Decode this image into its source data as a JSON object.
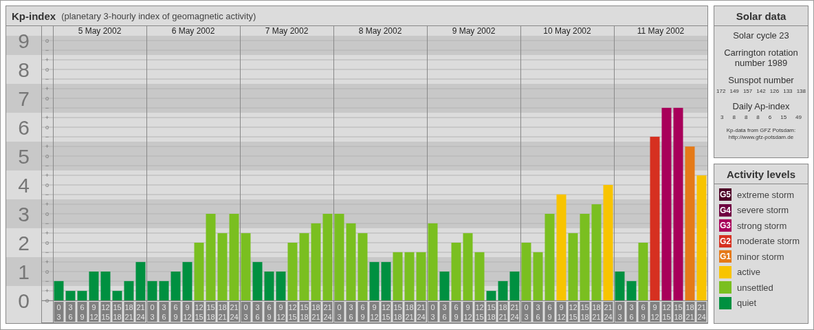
{
  "header": {
    "title": "Kp-index",
    "subtitle": "(planetary 3-hourly index of geomagnetic activity)"
  },
  "days": [
    "5 May 2002",
    "6 May 2002",
    "7 May 2002",
    "8 May 2002",
    "9 May 2002",
    "10 May 2002",
    "11 May 2002"
  ],
  "kp_subdivisions": [
    "o",
    "−",
    "+",
    "o",
    "−",
    "+",
    "o",
    "−",
    "+",
    "o",
    "−",
    "+",
    "o",
    "−",
    "+",
    "o",
    "−",
    "+",
    "o",
    "−",
    "+",
    "o",
    "−",
    "+",
    "o",
    "−",
    "+",
    "o"
  ],
  "chart_data": {
    "type": "bar",
    "grid": true,
    "categories": [
      "0 3",
      "3 6",
      "6 9",
      "9 12",
      "12 15",
      "15 18",
      "18 21",
      "21 24",
      "0 3",
      "3 6",
      "6 9",
      "9 12",
      "12 15",
      "15 18",
      "18 21",
      "21 24",
      "0 3",
      "3 6",
      "6 9",
      "9 12",
      "12 15",
      "15 18",
      "18 21",
      "21 24",
      "0 3",
      "3 6",
      "6 9",
      "9 12",
      "12 15",
      "15 18",
      "18 21",
      "21 24",
      "0 3",
      "3 6",
      "6 9",
      "9 12",
      "12 15",
      "15 18",
      "18 21",
      "21 24",
      "0 3",
      "3 6",
      "6 9",
      "9 12",
      "12 15",
      "15 18",
      "18 21",
      "21 24",
      "0 3",
      "3 6",
      "6 9",
      "9 12",
      "12 15",
      "15 18",
      "18 21",
      "21 24"
    ],
    "ylim": [
      0,
      9.5
    ],
    "yticks": [
      0,
      1,
      2,
      3,
      4,
      5,
      6,
      7,
      8,
      9
    ],
    "series": [
      {
        "color": "#009040",
        "values": [
          0.67,
          0.33,
          0.33,
          1,
          1,
          0.33,
          0.67,
          1.33,
          0.67,
          0.67,
          1,
          1.33,
          null,
          null,
          null,
          null,
          null,
          1.33,
          1,
          1,
          null,
          null,
          null,
          null,
          null,
          null,
          null,
          1.33,
          1.33,
          null,
          null,
          null,
          null,
          1,
          null,
          null,
          null,
          0.33,
          0.67,
          1,
          null,
          null,
          null,
          null,
          null,
          null,
          null,
          null,
          1,
          0.67,
          null,
          null,
          null,
          null,
          null,
          null
        ]
      },
      {
        "color": "#7abf20",
        "values": [
          null,
          null,
          null,
          null,
          null,
          null,
          null,
          null,
          null,
          null,
          null,
          null,
          2,
          3,
          2.33,
          3,
          2.33,
          null,
          null,
          null,
          2,
          2.33,
          2.67,
          3,
          3,
          2.67,
          2.33,
          null,
          null,
          1.67,
          1.67,
          1.67,
          2.67,
          null,
          2,
          2.33,
          1.67,
          null,
          null,
          null,
          2,
          1.67,
          3,
          null,
          2.33,
          3,
          3.33,
          null,
          null,
          null,
          2,
          null,
          null,
          null,
          null,
          null
        ]
      },
      {
        "color": "#f8c400",
        "values": [
          null,
          null,
          null,
          null,
          null,
          null,
          null,
          null,
          null,
          null,
          null,
          null,
          null,
          null,
          null,
          null,
          null,
          null,
          null,
          null,
          null,
          null,
          null,
          null,
          null,
          null,
          null,
          null,
          null,
          null,
          null,
          null,
          null,
          null,
          null,
          null,
          null,
          null,
          null,
          null,
          null,
          null,
          null,
          3.67,
          null,
          null,
          null,
          4,
          null,
          null,
          null,
          null,
          null,
          null,
          null,
          4.33
        ]
      },
      {
        "color": "#e57a18",
        "values": [
          null,
          null,
          null,
          null,
          null,
          null,
          null,
          null,
          null,
          null,
          null,
          null,
          null,
          null,
          null,
          null,
          null,
          null,
          null,
          null,
          null,
          null,
          null,
          null,
          null,
          null,
          null,
          null,
          null,
          null,
          null,
          null,
          null,
          null,
          null,
          null,
          null,
          null,
          null,
          null,
          null,
          null,
          null,
          null,
          null,
          null,
          null,
          null,
          null,
          null,
          null,
          null,
          null,
          null,
          5.33,
          null
        ]
      },
      {
        "color": "#d63020",
        "values": [
          null,
          null,
          null,
          null,
          null,
          null,
          null,
          null,
          null,
          null,
          null,
          null,
          null,
          null,
          null,
          null,
          null,
          null,
          null,
          null,
          null,
          null,
          null,
          null,
          null,
          null,
          null,
          null,
          null,
          null,
          null,
          null,
          null,
          null,
          null,
          null,
          null,
          null,
          null,
          null,
          null,
          null,
          null,
          null,
          null,
          null,
          null,
          null,
          null,
          null,
          null,
          5.67,
          null,
          null,
          null,
          null
        ]
      },
      {
        "color": "#a8005a",
        "values": [
          null,
          null,
          null,
          null,
          null,
          null,
          null,
          null,
          null,
          null,
          null,
          null,
          null,
          null,
          null,
          null,
          null,
          null,
          null,
          null,
          null,
          null,
          null,
          null,
          null,
          null,
          null,
          null,
          null,
          null,
          null,
          null,
          null,
          null,
          null,
          null,
          null,
          null,
          null,
          null,
          null,
          null,
          null,
          null,
          null,
          null,
          null,
          null,
          null,
          null,
          null,
          null,
          6.67,
          6.67,
          null,
          null
        ]
      }
    ]
  },
  "solar_data": {
    "title": "Solar data",
    "cycle": "Solar cycle 23",
    "carrington": "Carrington rotation number 1989",
    "sunspot_label": "Sunspot number",
    "sunspot_numbers": [
      "172",
      "149",
      "157",
      "142",
      "126",
      "133",
      "138"
    ],
    "ap_label": "Daily Ap-index",
    "ap_values": [
      "3",
      "8",
      "8",
      "8",
      "6",
      "15",
      "49"
    ],
    "credit": "Kp-data from GFZ Potsdam:",
    "credit_url": "http://www.gfz-potsdam.de"
  },
  "activity_levels": {
    "title": "Activity levels",
    "items": [
      {
        "badge": "G5",
        "label": "extreme storm",
        "color": "#4d0026"
      },
      {
        "badge": "G4",
        "label": "severe storm",
        "color": "#6e0040"
      },
      {
        "badge": "G3",
        "label": "strong storm",
        "color": "#a8005a"
      },
      {
        "badge": "G2",
        "label": "moderate storm",
        "color": "#d63020"
      },
      {
        "badge": "G1",
        "label": "minor storm",
        "color": "#e57a18"
      },
      {
        "label": "active",
        "color": "#f8c400"
      },
      {
        "label": "unsettled",
        "color": "#7abf20"
      },
      {
        "label": "quiet",
        "color": "#009040"
      }
    ]
  }
}
